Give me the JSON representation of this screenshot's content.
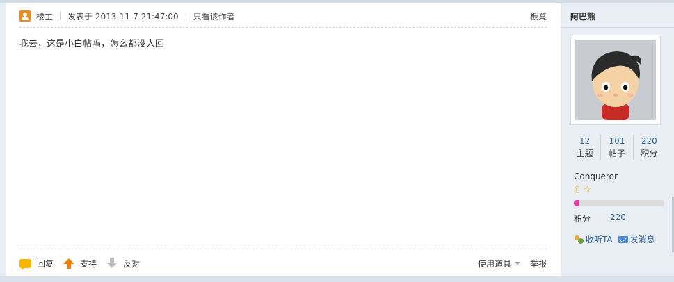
{
  "post": {
    "header": {
      "owner_label": "楼主",
      "posted_at": "发表于 2013-11-7 21:47:00",
      "only_author": "只看该作者",
      "floor": "板凳"
    },
    "content": "我去，这是小白帖吗，怎么都没人回",
    "footer": {
      "reply": "回复",
      "support": "支持",
      "oppose": "反对",
      "tools": "使用道具",
      "report": "举报"
    }
  },
  "author": {
    "name": "阿巴熊",
    "stats": [
      {
        "value": "12",
        "label": "主题"
      },
      {
        "value": "101",
        "label": "帖子"
      },
      {
        "value": "220",
        "label": "积分"
      }
    ],
    "rank": "Conqueror",
    "medals": [
      "moon-icon",
      "star-icon"
    ],
    "progress": 0.05,
    "score_label": "积分",
    "score_value": "220",
    "follow": "收听TA",
    "message": "发消息"
  },
  "colors": {
    "accent": "#f08c1c",
    "link": "#336699",
    "progress": "#e83ba5",
    "sidebar_bg": "#e8eef4"
  }
}
